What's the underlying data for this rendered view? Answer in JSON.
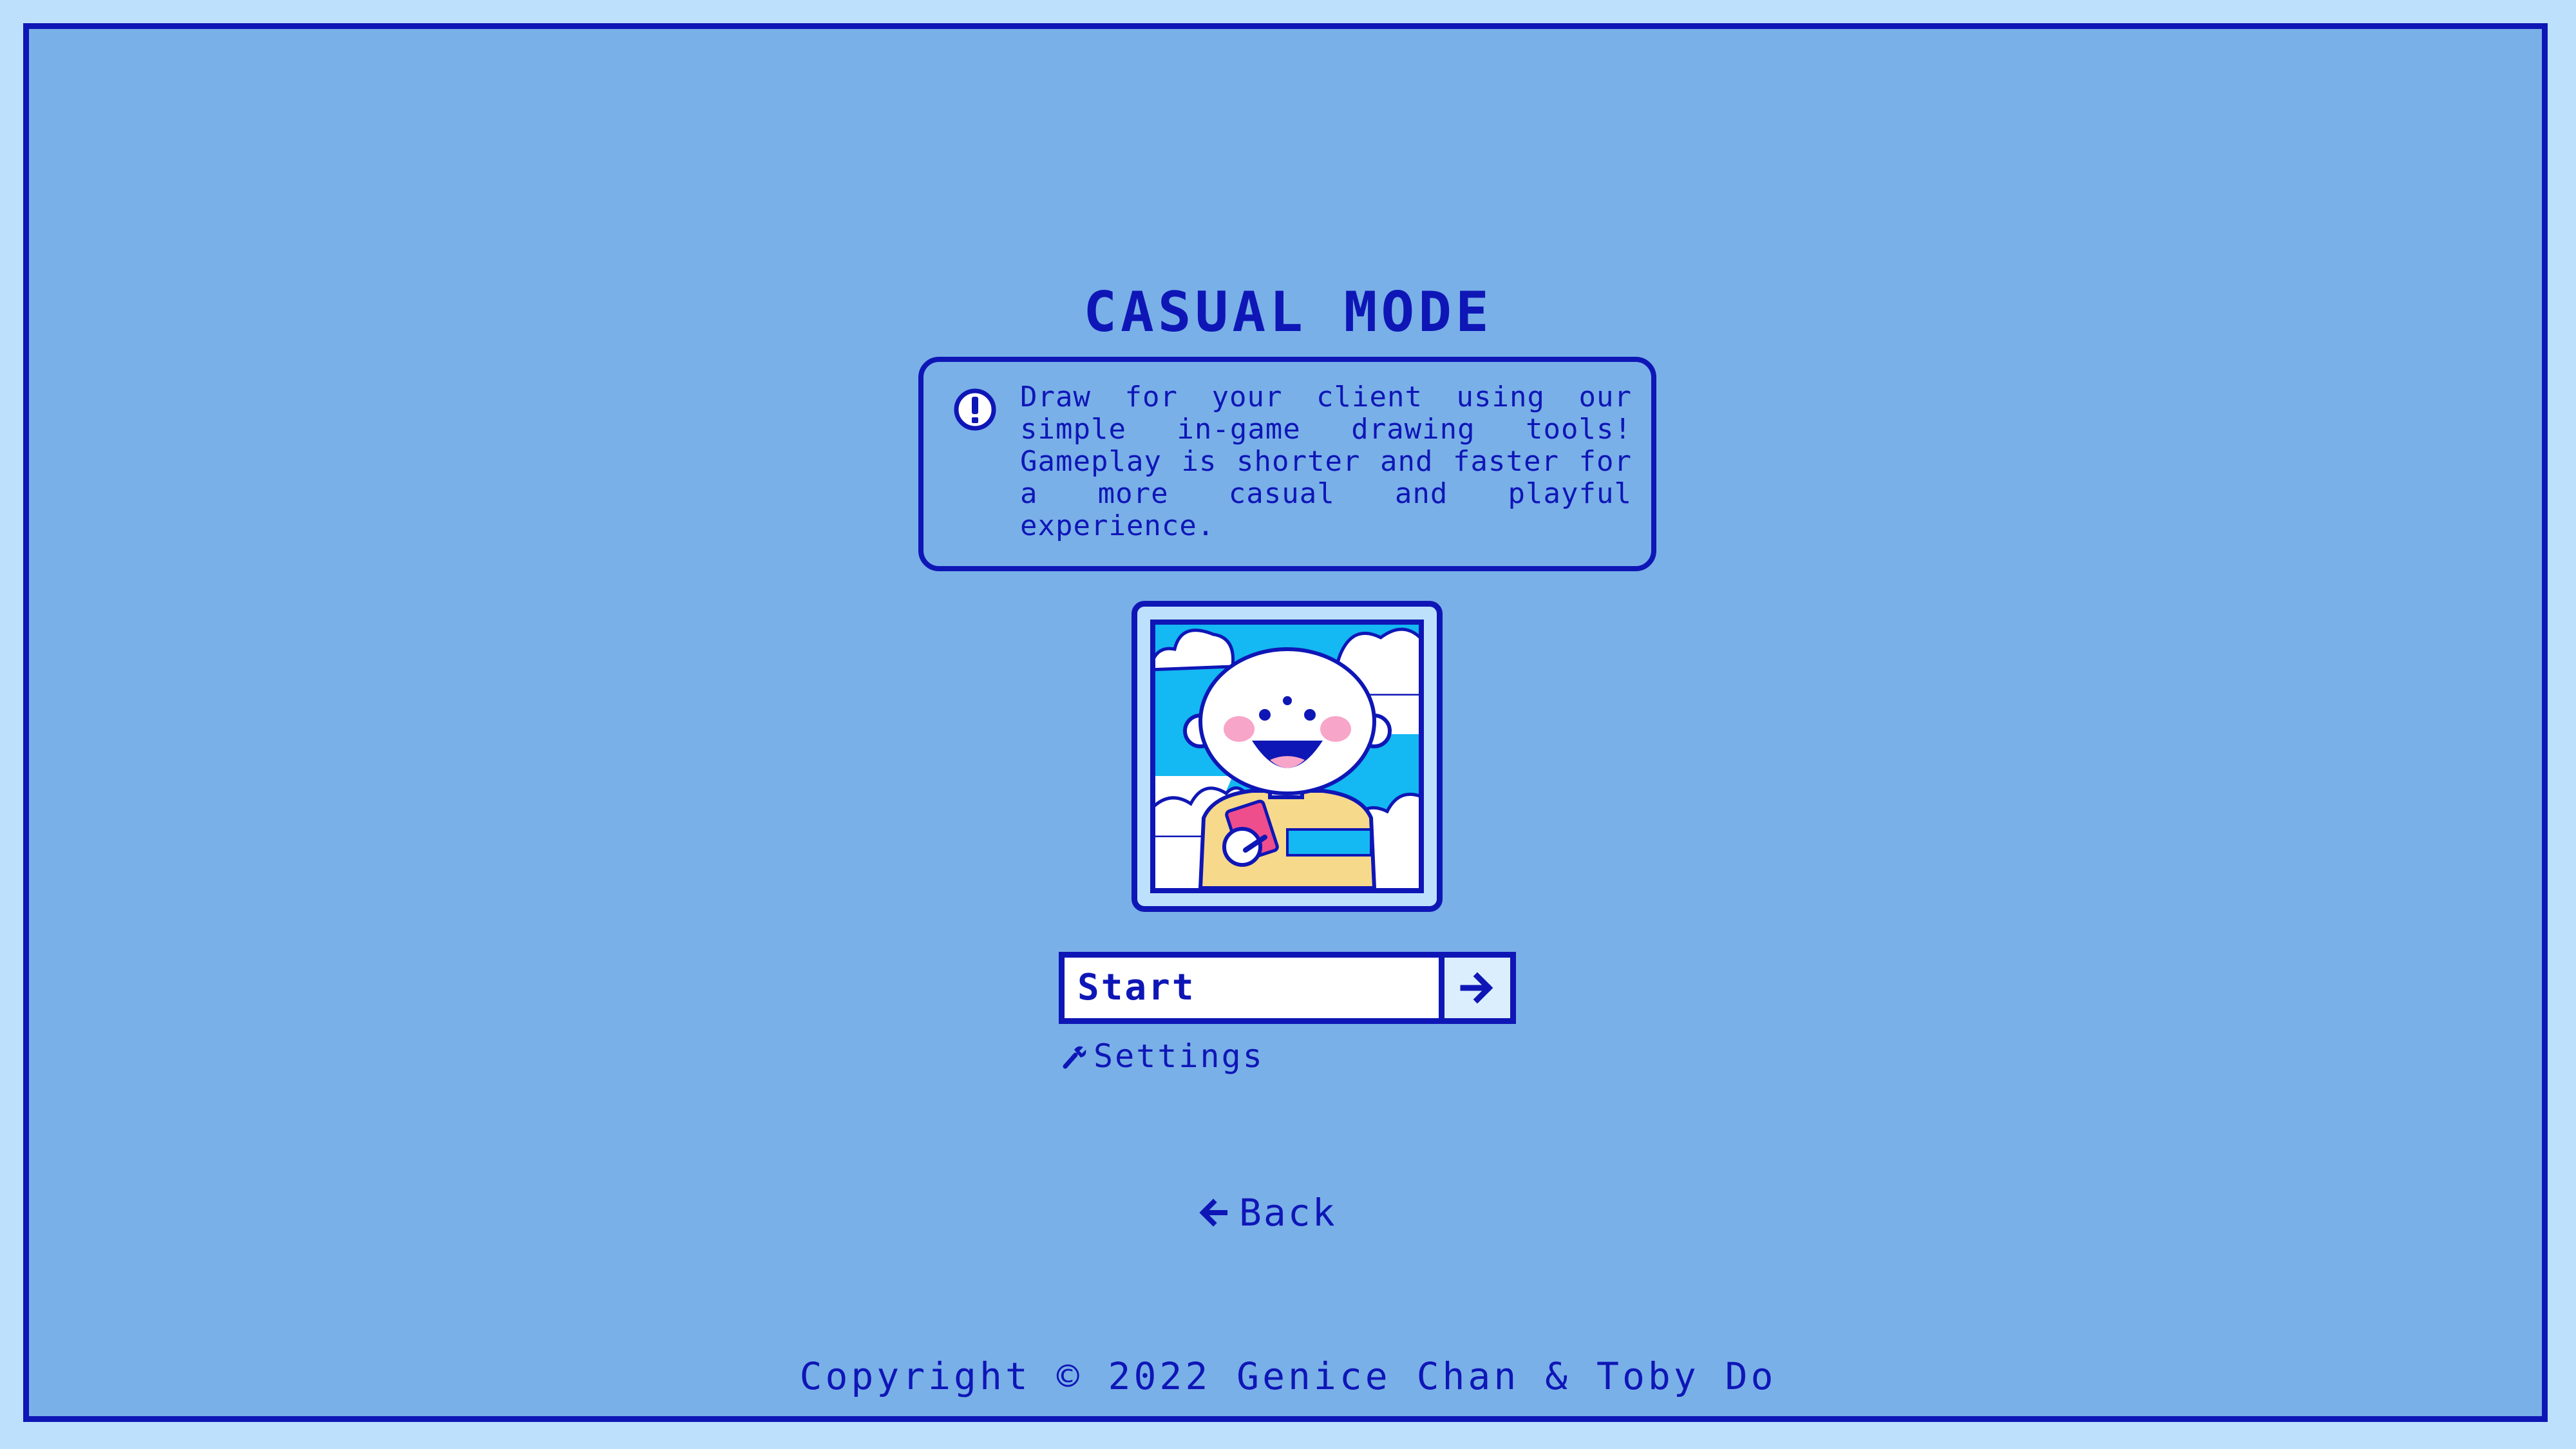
{
  "mode": {
    "title": "CASUAL MODE",
    "description": "Draw for your client using our simple in-game drawing tools! Gameplay is shorter and faster for a more casual and playful experience.",
    "info_icon": "exclamation-circle-icon",
    "illustration": "smiling-bald-character-with-phone-icon"
  },
  "actions": {
    "start_label": "Start",
    "start_icon": "arrow-right-icon",
    "settings_label": "Settings",
    "settings_icon": "wrench-icon",
    "back_label": "Back",
    "back_icon": "arrow-left-icon"
  },
  "footer": {
    "copyright": "Copyright © 2022 Genice Chan & Toby Do"
  },
  "colors": {
    "page_background": "#bde1fd",
    "panel_background": "#79b0e8",
    "primary": "#0f16b6",
    "sky": "#14b8f2",
    "cheek": "#f7a5c8",
    "shirt": "#f6d98a",
    "phone": "#ee4e8c"
  }
}
